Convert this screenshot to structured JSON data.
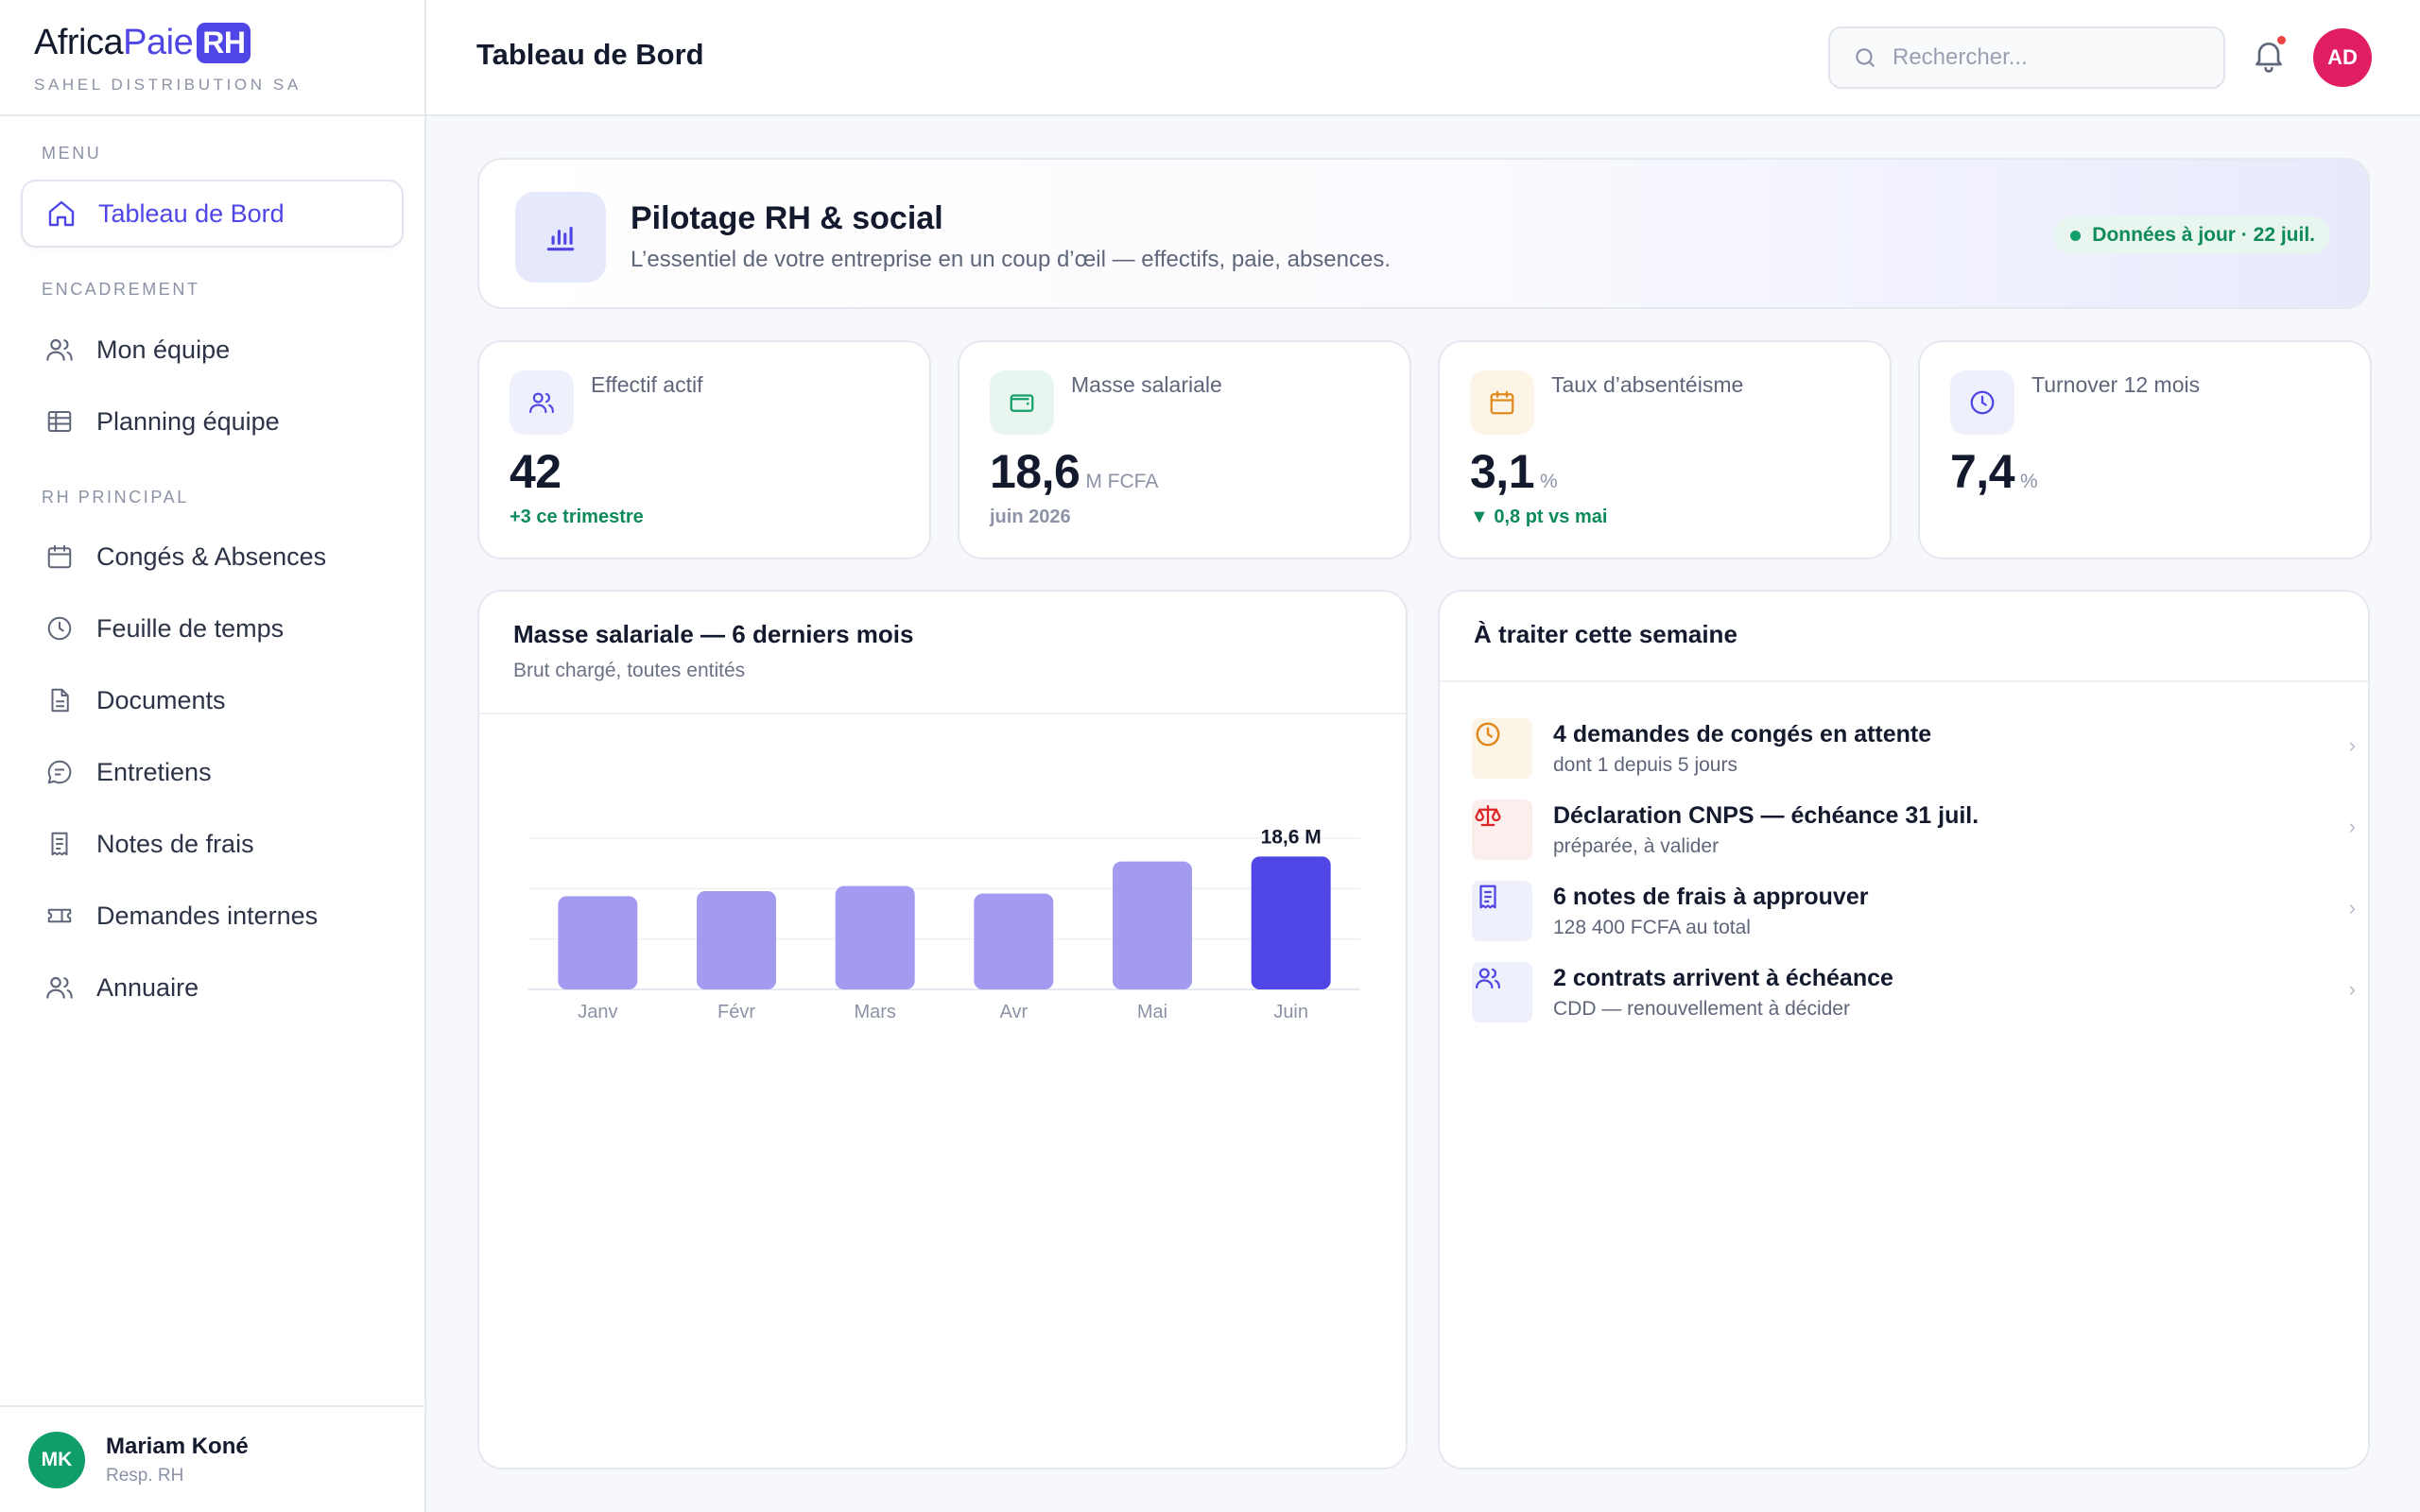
{
  "brand": {
    "part1": "Africa",
    "part2": "Paie",
    "badge": "RH",
    "company": "SAHEL DISTRIBUTION SA"
  },
  "sidebar": {
    "sections": {
      "menu": "MENU",
      "encadrement": "ENCADREMENT",
      "rh_principal": "RH PRINCIPAL"
    },
    "items": [
      {
        "label": "Tableau de Bord",
        "icon": "home-icon",
        "active": true
      },
      {
        "label": "Mon équipe",
        "icon": "users-icon"
      },
      {
        "label": "Planning équipe",
        "icon": "table-icon"
      },
      {
        "label": "Congés & Absences",
        "icon": "calendar-icon"
      },
      {
        "label": "Feuille de temps",
        "icon": "clock-icon"
      },
      {
        "label": "Documents",
        "icon": "document-icon"
      },
      {
        "label": "Entretiens",
        "icon": "chat-icon"
      },
      {
        "label": "Notes de frais",
        "icon": "receipt-icon"
      },
      {
        "label": "Demandes internes",
        "icon": "ticket-icon"
      },
      {
        "label": "Annuaire",
        "icon": "users-icon"
      }
    ],
    "user": {
      "initials": "MK",
      "name": "Mariam Koné",
      "role": "Resp. RH"
    }
  },
  "header": {
    "title": "Tableau de Bord",
    "search_placeholder": "Rechercher...",
    "avatar": "AD"
  },
  "hero": {
    "title": "Pilotage RH & social",
    "subtitle": "L’essentiel de votre entreprise en un coup d’œil — effectifs, paie, absences.",
    "badge": "Données à jour · 22 juil."
  },
  "kpis": [
    {
      "label": "Effectif actif",
      "value": "42",
      "unit": "",
      "foot": "+3 ce trimestre",
      "icon": "users-icon",
      "color": "#4f46e5"
    },
    {
      "label": "Masse salariale",
      "value": "18,6",
      "unit": "M FCFA",
      "foot": "juin 2026",
      "icon": "wallet-icon",
      "color": "#12a06a"
    },
    {
      "label": "Taux d’absentéisme",
      "value": "3,1",
      "unit": "%",
      "foot": "▼ 0,8 pt vs mai",
      "icon": "calendar-icon",
      "color": "#e08a1e"
    },
    {
      "label": "Turnover 12 mois",
      "value": "7,4",
      "unit": "%",
      "foot": "",
      "icon": "clock-icon",
      "color": "#4f46e5"
    }
  ],
  "payroll_panel": {
    "title": "Masse salariale — 6 derniers mois",
    "subtitle": "Brut chargé, toutes entités"
  },
  "chart_data": {
    "type": "bar",
    "categories": [
      "Janv",
      "Févr",
      "Mars",
      "Avr",
      "Mai",
      "Juin"
    ],
    "values": [
      14.8,
      15.6,
      16.4,
      15.2,
      20.3,
      21.1
    ],
    "highlight_index": 5,
    "highlight_label": "18,6 M",
    "title": "Masse salariale — 6 derniers mois",
    "ylim": [
      0,
      24
    ],
    "grid": true,
    "colors": {
      "bar": "#a29bf0",
      "highlight": "#4f46e5"
    }
  },
  "todo_panel": {
    "title": "À traiter cette semaine",
    "items": [
      {
        "title": "4 demandes de congés en attente",
        "sub": "dont 1 depuis 5 jours",
        "icon": "clock-icon",
        "color": "#e08a1e",
        "bg": "#fdf4e8"
      },
      {
        "title": "Déclaration CNPS — échéance 31 juil.",
        "sub": "préparée, à valider",
        "icon": "scale-icon",
        "color": "#dc2626",
        "bg": "#fdeeee"
      },
      {
        "title": "6 notes de frais à approuver",
        "sub": "128 400 FCFA au total",
        "icon": "receipt-icon",
        "color": "#4f46e5",
        "bg": "#eef0fb"
      },
      {
        "title": "2 contrats arrivent à échéance",
        "sub": "CDD — renouvellement à décider",
        "icon": "users-icon",
        "color": "#4f46e5",
        "bg": "#eef0fb"
      }
    ]
  }
}
